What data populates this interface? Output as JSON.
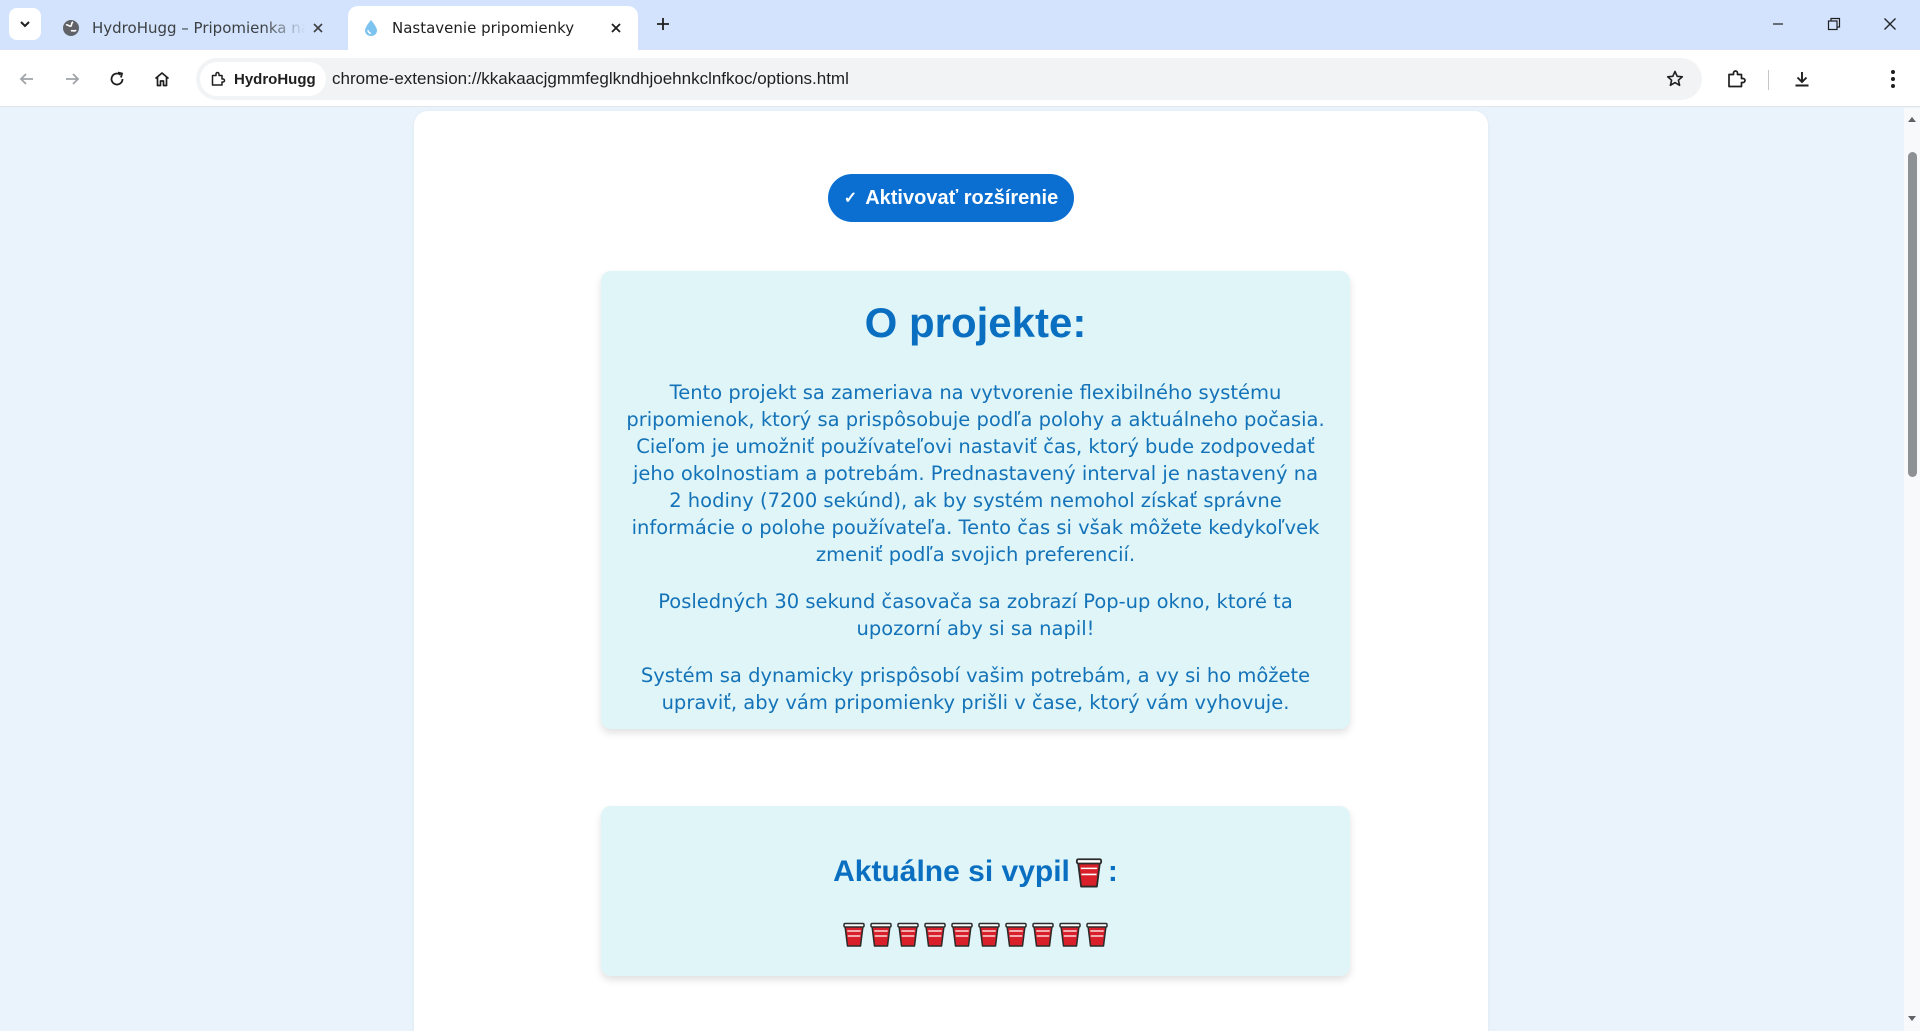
{
  "browser": {
    "tabs": [
      {
        "title": "HydroHugg – Pripomienka na pitie",
        "favicon": "globe-icon",
        "active": false
      },
      {
        "title": "Nastavenie pripomienky",
        "favicon": "water-drop-icon",
        "active": true
      }
    ],
    "site_chip": "HydroHugg",
    "url": "chrome-extension://kkakaacjgmmfeglkndhjoehnkclnfkoc/options.html"
  },
  "page": {
    "activate_button_label": "Aktivovať rozšírenie",
    "about": {
      "heading": "O projekte:",
      "paragraphs": [
        "Tento projekt sa zameriava na vytvorenie flexibilného systému pripomienok, ktorý sa prispôsobuje podľa polohy a aktuálneho počasia. Cieľom je umožniť používateľovi nastaviť čas, ktorý bude zodpovedať jeho okolnostiam a potrebám. Prednastavený interval je nastavený na 2 hodiny (7200 sekúnd), ak by systém nemohol získať správne informácie o polohe používateľa. Tento čas si však môžete kedykoľvek zmeniť podľa svojich preferencií.",
        "Posledných 30 sekund časovača sa zobrazí Pop-up okno, ktoré ta upozorní aby si sa napil!",
        "Systém sa dynamicky prispôsobí vašim potrebám, a vy si ho môžete upraviť, aby vám pripomienky prišli v čase, ktorý vám vyhovuje."
      ]
    },
    "drinks": {
      "heading_text": "Aktuálne si vypil",
      "heading_suffix": ":",
      "cup_icon": "red-cup-icon",
      "cup_count": 10
    }
  },
  "colors": {
    "accent": "#0a6fd1",
    "panel_bg": "#dff5f8",
    "text_blue": "#1473b8",
    "cup_red": "#d9202a"
  }
}
